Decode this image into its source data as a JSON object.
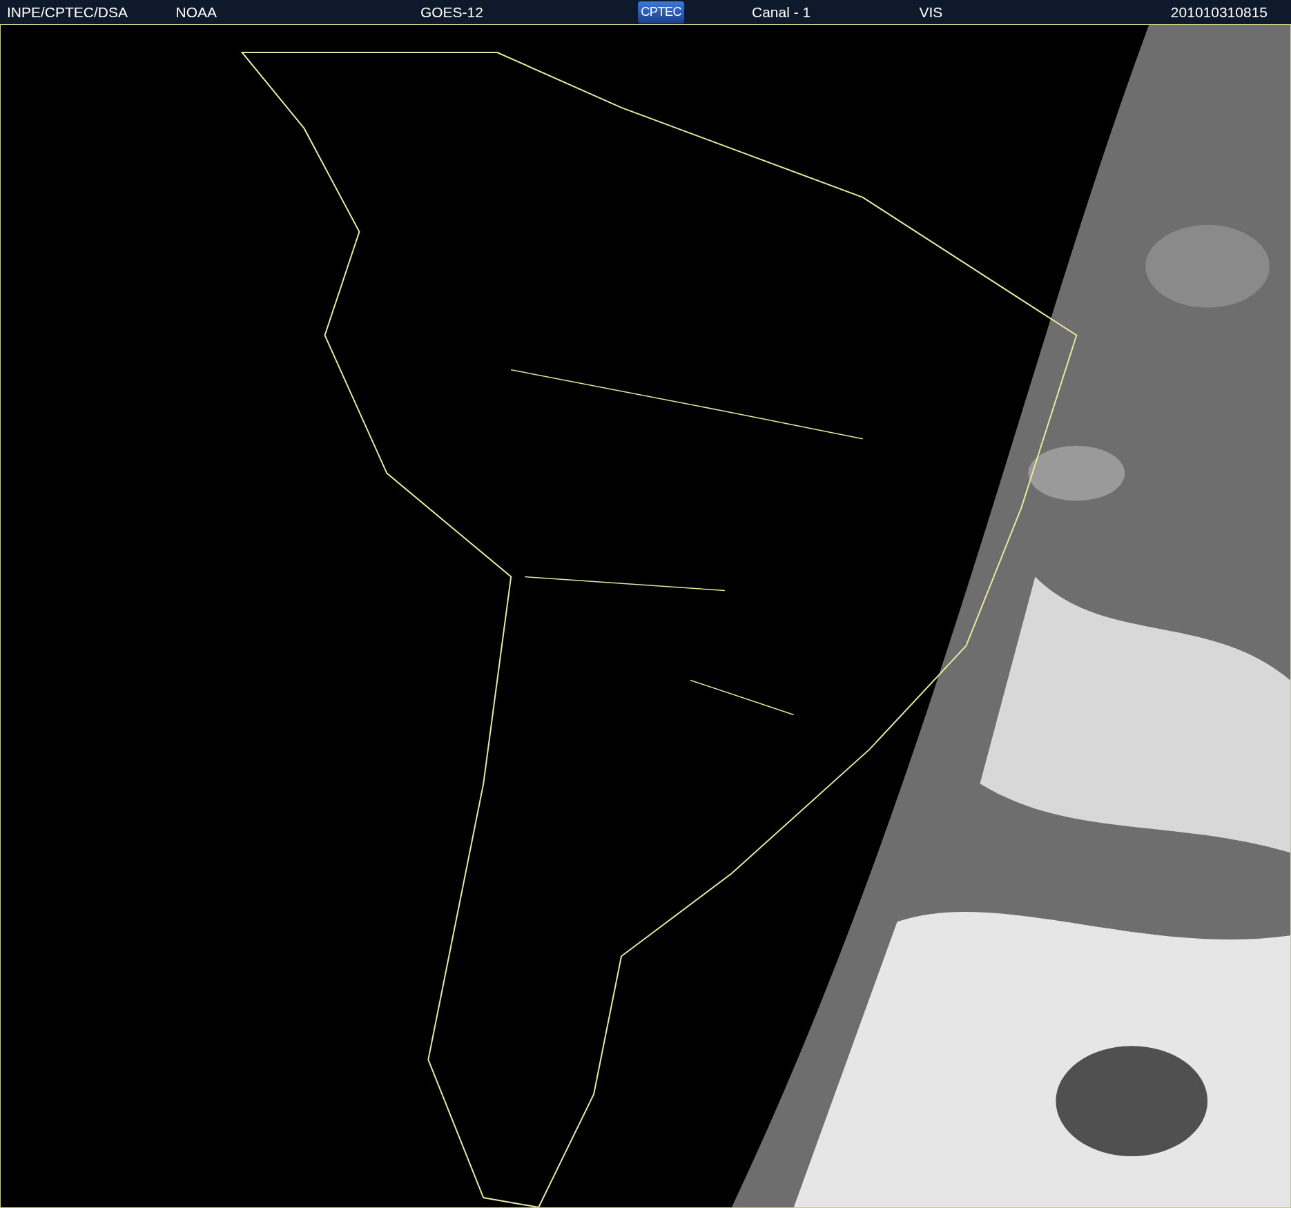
{
  "header": {
    "items": [
      {
        "kind": "text",
        "text": "INPE/CPTEC/DSA"
      },
      {
        "kind": "text",
        "text": "NOAA"
      },
      {
        "kind": "text",
        "text": "GOES-12"
      },
      {
        "kind": "logo",
        "text": "CPTEC"
      },
      {
        "kind": "text",
        "text": "Canal - 1"
      },
      {
        "kind": "text",
        "text": "VIS"
      },
      {
        "kind": "text",
        "text": "201010310815"
      }
    ]
  }
}
